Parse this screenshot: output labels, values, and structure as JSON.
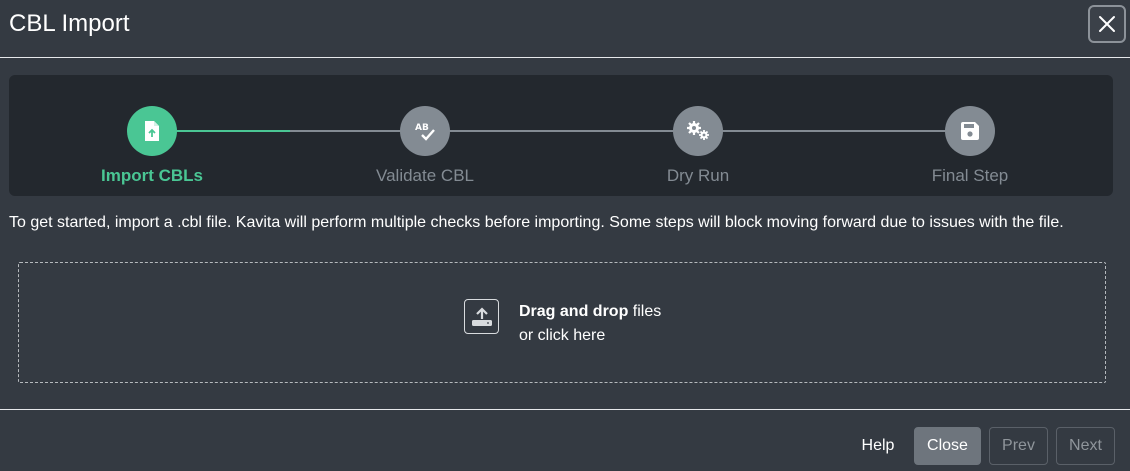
{
  "dialog": {
    "title": "CBL Import",
    "close_icon": "close-icon"
  },
  "stepper": {
    "colors": {
      "active": "#4ac694",
      "inactive": "#838b93"
    },
    "steps": [
      {
        "label": "Import CBLs",
        "icon": "file-upload-icon",
        "state": "active"
      },
      {
        "label": "Validate CBL",
        "icon": "spell-check-icon",
        "state": "pending"
      },
      {
        "label": "Dry Run",
        "icon": "gears-icon",
        "state": "pending"
      },
      {
        "label": "Final Step",
        "icon": "floppy-disk-icon",
        "state": "pending"
      }
    ]
  },
  "intro_text": "To get started, import a .cbl file. Kavita will perform multiple checks before importing. Some steps will block moving forward due to issues with the file.",
  "dropzone": {
    "icon": "upload-icon",
    "bold_text": "Drag and drop",
    "text_after_bold": " files",
    "line2": "or click here"
  },
  "footer": {
    "help_label": "Help",
    "close_label": "Close",
    "prev_label": "Prev",
    "next_label": "Next"
  }
}
